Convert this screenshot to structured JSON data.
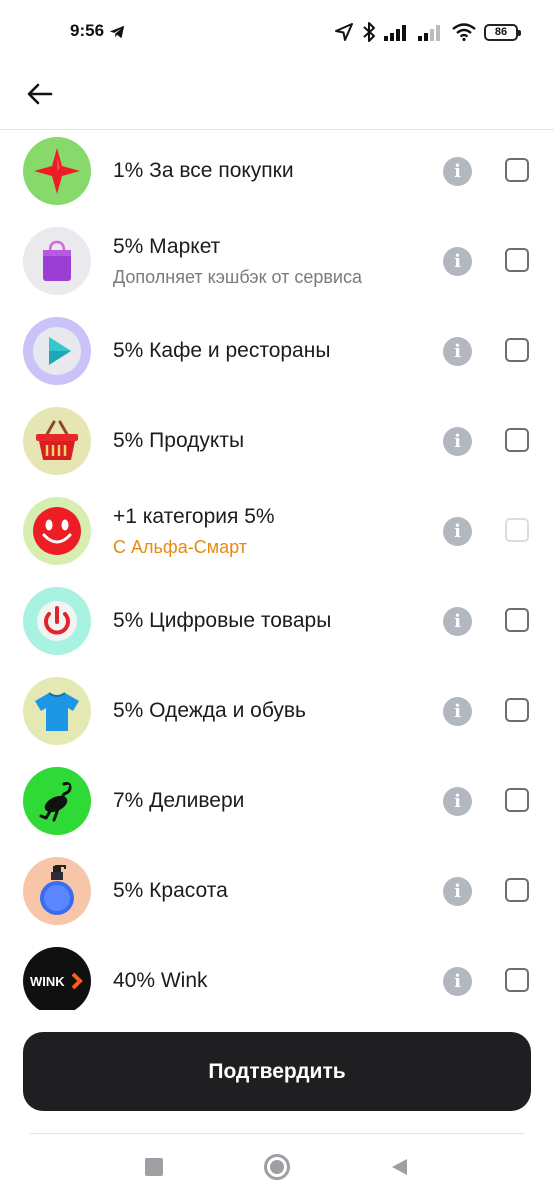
{
  "status_bar": {
    "time": "9:56",
    "battery": "86",
    "icons": [
      "telegram-icon",
      "location-icon",
      "bluetooth-icon",
      "signal-icon",
      "signal-icon",
      "wifi-icon",
      "battery-icon"
    ]
  },
  "header": {
    "back_icon": "arrow-left-icon"
  },
  "categories": [
    {
      "title": "1% За все покупки",
      "subtitle": "",
      "icon": "red-star-icon",
      "icon_bg": "#86d96a"
    },
    {
      "title": "5% Маркет",
      "subtitle": "Дополняет кэшбэк от сервиса",
      "subtitle_color": "#7a7a80",
      "icon": "shopping-bag-icon",
      "icon_bg": "#e9e9ee"
    },
    {
      "title": "5% Кафе и рестораны",
      "subtitle": "",
      "icon": "play-icon",
      "icon_bg": "#c9c3f7"
    },
    {
      "title": "5% Продукты",
      "subtitle": "",
      "icon": "basket-icon",
      "icon_bg": "#e6e6b5"
    },
    {
      "title": "+1 категория 5%",
      "subtitle": "С Альфа-Смарт",
      "subtitle_color": "#e88a10",
      "icon": "smiley-icon",
      "icon_bg": "#d6efb0",
      "disabled": true
    },
    {
      "title": "5% Цифровые товары",
      "subtitle": "",
      "icon": "power-icon",
      "icon_bg": "#a8f2e2"
    },
    {
      "title": "5% Одежда и обувь",
      "subtitle": "",
      "icon": "tshirt-icon",
      "icon_bg": "#e4e9b3"
    },
    {
      "title": "7% Деливери",
      "subtitle": "",
      "icon": "ostrich-icon",
      "icon_bg": "#2fd936"
    },
    {
      "title": "5% Красота",
      "subtitle": "",
      "icon": "perfume-bottle-icon",
      "icon_bg": "#f7c6a8"
    },
    {
      "title": "40% Wink",
      "subtitle": "",
      "icon": "wink-logo-icon",
      "icon_bg": "#101010",
      "logo_text": "WINK"
    }
  ],
  "confirm_button": {
    "label": "Подтвердить"
  },
  "nav_bar": {
    "icons": [
      "recent-apps-icon",
      "home-icon",
      "back-icon"
    ]
  },
  "colors": {
    "button_bg": "#1f1f21",
    "info_icon": "#b3b7bf",
    "accent_orange": "#e88a10"
  }
}
